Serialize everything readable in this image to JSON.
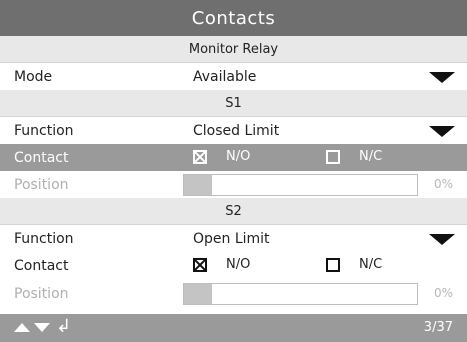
{
  "title": "Contacts",
  "monitor_relay": {
    "header": "Monitor Relay",
    "mode_label": "Mode",
    "mode_value": "Available"
  },
  "s1": {
    "header": "S1",
    "function_label": "Function",
    "function_value": "Closed Limit",
    "contact_label": "Contact",
    "no_label": "N/O",
    "nc_label": "N/C",
    "no_checked": true,
    "nc_checked": false,
    "position_label": "Position",
    "position_value": "0%",
    "position_fraction": 0
  },
  "s2": {
    "header": "S2",
    "function_label": "Function",
    "function_value": "Open Limit",
    "contact_label": "Contact",
    "no_label": "N/O",
    "nc_label": "N/C",
    "no_checked": true,
    "nc_checked": false,
    "position_label": "Position",
    "position_value": "0%",
    "position_fraction": 0
  },
  "footer": {
    "page": "3/37",
    "icons": [
      "up-arrow-icon",
      "down-arrow-icon",
      "enter-icon"
    ]
  },
  "colors": {
    "title_bar": "#6f6f6f",
    "selected_row": "#9a9a9a",
    "section_bg": "#e8e8e8"
  }
}
